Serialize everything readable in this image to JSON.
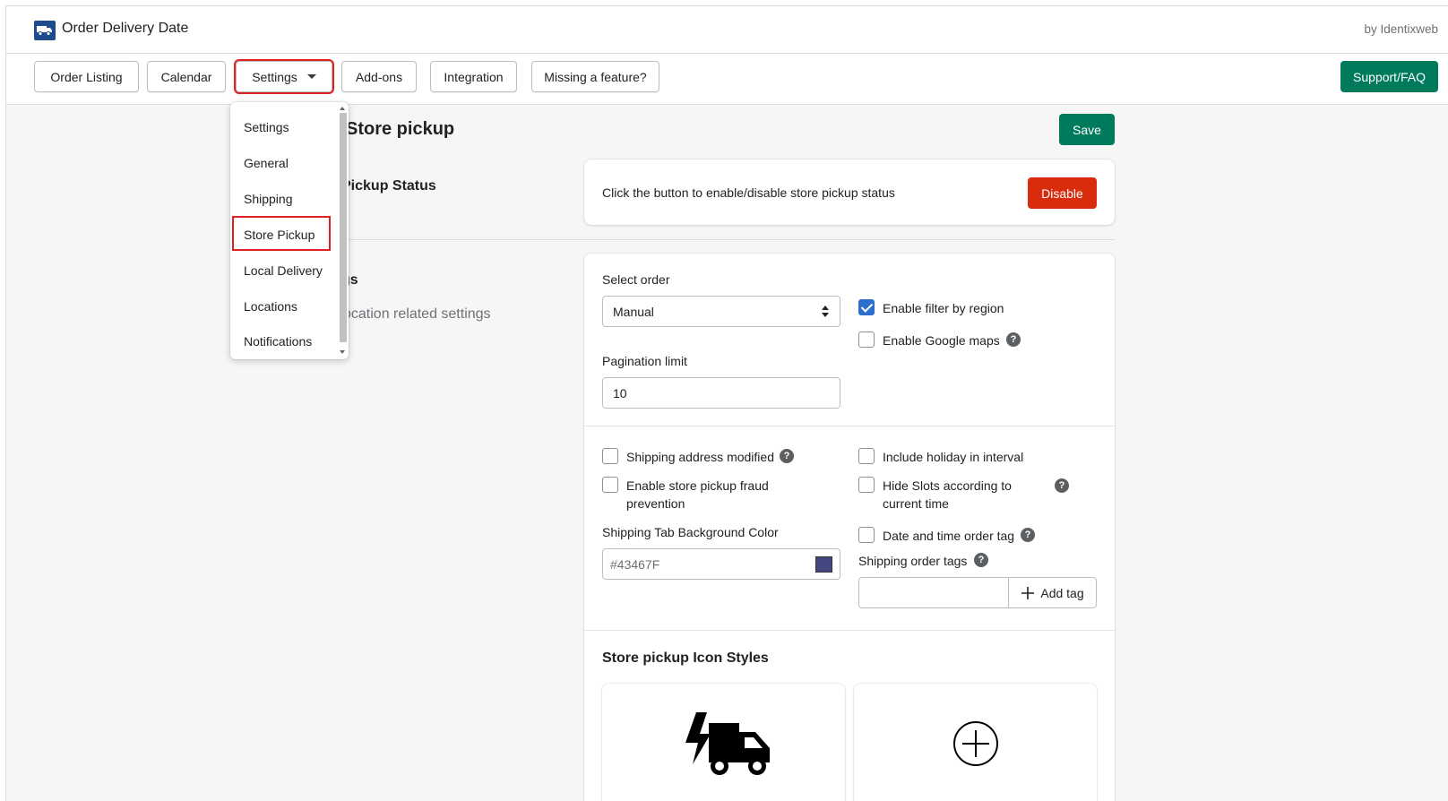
{
  "app": {
    "title": "Order Delivery Date",
    "by_line": "by Identixweb"
  },
  "nav": {
    "order_listing": "Order Listing",
    "calendar": "Calendar",
    "settings": "Settings",
    "addons": "Add-ons",
    "integration": "Integration",
    "missing_feature": "Missing a feature?",
    "support": "Support/FAQ"
  },
  "dropdown": {
    "items": [
      "Settings",
      "General",
      "Shipping",
      "Store Pickup",
      "Local Delivery",
      "Locations",
      "Notifications"
    ],
    "selected": "Store Pickup"
  },
  "page": {
    "title_fragment": "Store pickup",
    "save_label": "Save",
    "pickup_status_heading_fragment": "Pickup Status",
    "settings_heading_fragment": "gs",
    "settings_sub_fragment": "ocation related settings"
  },
  "status_card": {
    "text": "Click the button to enable/disable store pickup status",
    "disable_label": "Disable"
  },
  "settings_card": {
    "select_order_label": "Select order",
    "select_order_value": "Manual",
    "pagination_label": "Pagination limit",
    "pagination_value": "10",
    "enable_filter_region": {
      "label": "Enable filter by region",
      "checked": true
    },
    "enable_google_maps": {
      "label": "Enable Google maps",
      "checked": false
    },
    "shipping_address_modified": {
      "label": "Shipping address modified",
      "checked": false
    },
    "include_holiday": {
      "label": "Include holiday in interval",
      "checked": false
    },
    "fraud_prevention": {
      "label_line1": "Enable store pickup fraud",
      "label_line2": "prevention",
      "checked": false
    },
    "hide_slots": {
      "label_line1": "Hide Slots according to",
      "label_line2": "current time",
      "checked": false
    },
    "bg_color_label": "Shipping Tab Background Color",
    "bg_color_value": "#43467F",
    "date_time_tag": {
      "label": "Date and time order tag",
      "checked": false
    },
    "shipping_order_tags_label": "Shipping order tags",
    "add_tag_label": "Add tag",
    "help_glyph": "?"
  },
  "icon_styles": {
    "heading": "Store pickup Icon Styles"
  },
  "colors": {
    "primary": "#007a5c",
    "critical": "#d82c0d",
    "checkbox": "#2c6ecb",
    "highlight": "#e02020"
  }
}
